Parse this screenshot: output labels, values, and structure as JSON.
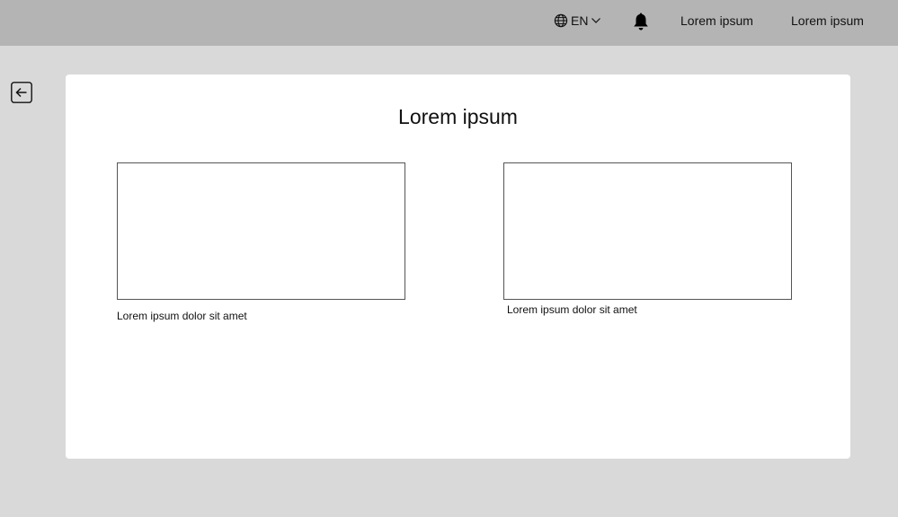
{
  "header": {
    "language": "EN",
    "links": [
      "Lorem ipsum",
      "Lorem ipsum"
    ]
  },
  "icons": {
    "globe": "globe-icon",
    "chevron": "chevron-down-icon",
    "bell": "bell-icon",
    "back": "arrow-left-icon"
  },
  "main": {
    "title": "Lorem ipsum",
    "items": [
      {
        "caption": "Lorem ipsum dolor sit amet"
      },
      {
        "caption": "Lorem ipsum dolor sit amet"
      }
    ]
  },
  "colors": {
    "topbar": "#b4b4b4",
    "background": "#d9d9d9",
    "card": "#ffffff"
  }
}
